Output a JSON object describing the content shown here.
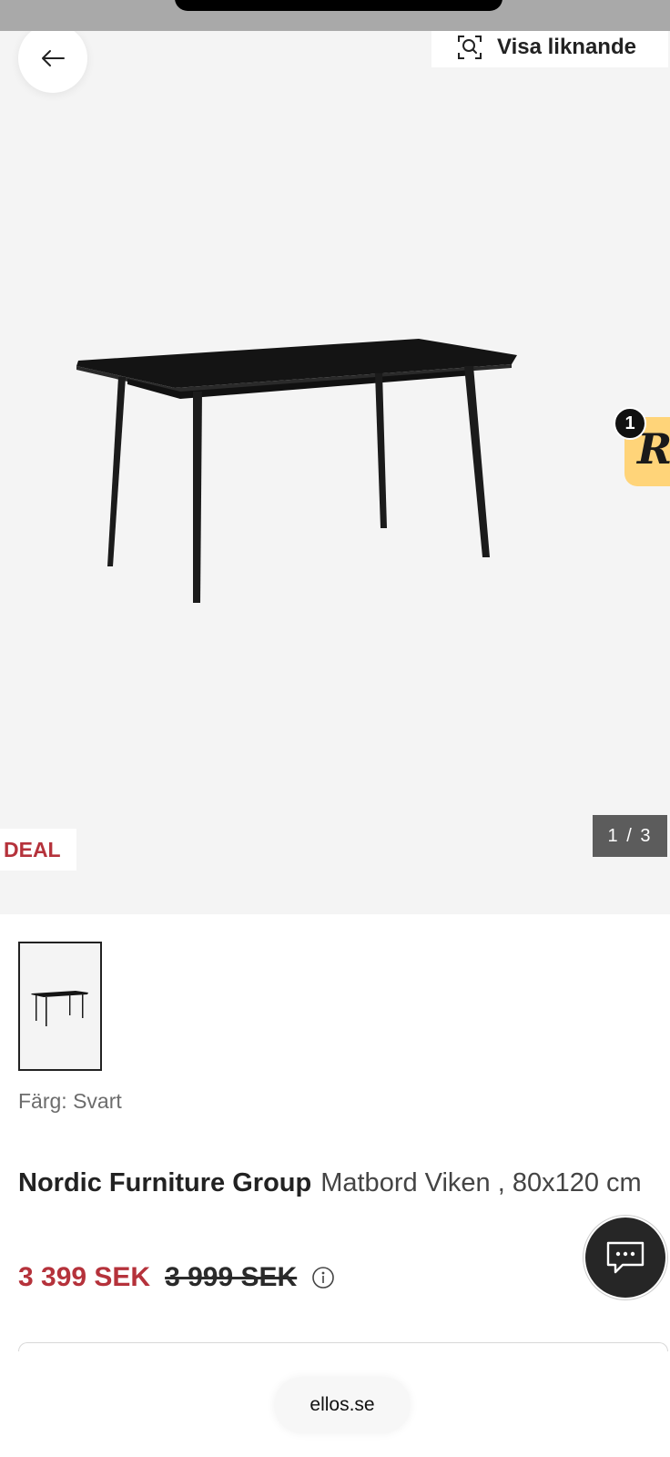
{
  "gallery": {
    "similar_label": "Visa liknande",
    "deal_label": "DEAL",
    "counter": "1 / 3",
    "badge_count": "1",
    "badge_glyph": "R"
  },
  "product": {
    "color_label": "Färg: Svart",
    "brand": "Nordic Furniture Group",
    "name": "Matbord Viken , 80x120 cm",
    "price_current": "3 399 SEK",
    "price_original": "3 999 SEK"
  },
  "browser": {
    "url": "ellos.se"
  },
  "icons": {
    "back": "arrow-left-icon",
    "similar": "visual-search-icon",
    "info": "info-icon",
    "chat": "chat-bubble-icon"
  },
  "colors": {
    "accent_red": "#b5323b",
    "badge_yellow": "#ffd479",
    "hero_bg": "#f4f4f4"
  }
}
